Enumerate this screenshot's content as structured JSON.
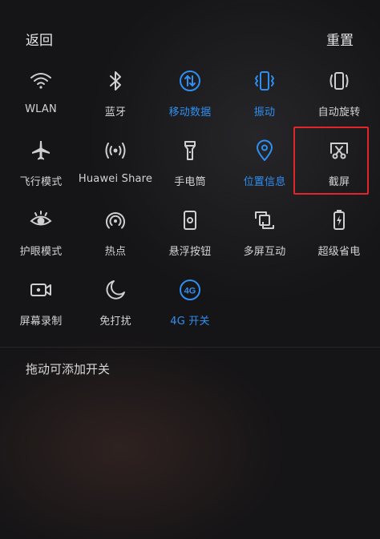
{
  "header": {
    "back_label": "返回",
    "reset_label": "重置"
  },
  "tiles": [
    {
      "label": "WLAN",
      "icon": "wifi-icon",
      "active": false
    },
    {
      "label": "蓝牙",
      "icon": "bluetooth-icon",
      "active": false
    },
    {
      "label": "移动数据",
      "icon": "mobile-data-icon",
      "active": true
    },
    {
      "label": "振动",
      "icon": "vibrate-icon",
      "active": true
    },
    {
      "label": "自动旋转",
      "icon": "auto-rotate-icon",
      "active": false
    },
    {
      "label": "飞行模式",
      "icon": "airplane-icon",
      "active": false
    },
    {
      "label": "Huawei Share",
      "icon": "huawei-share-icon",
      "active": false
    },
    {
      "label": "手电筒",
      "icon": "flashlight-icon",
      "active": false
    },
    {
      "label": "位置信息",
      "icon": "location-icon",
      "active": true
    },
    {
      "label": "截屏",
      "icon": "screenshot-icon",
      "active": false
    },
    {
      "label": "护眼模式",
      "icon": "eye-comfort-icon",
      "active": false
    },
    {
      "label": "热点",
      "icon": "hotspot-icon",
      "active": false
    },
    {
      "label": "悬浮按钮",
      "icon": "floating-button-icon",
      "active": false
    },
    {
      "label": "多屏互动",
      "icon": "multi-screen-icon",
      "active": false
    },
    {
      "label": "超级省电",
      "icon": "power-saving-icon",
      "active": false
    },
    {
      "label": "屏幕录制",
      "icon": "screen-record-icon",
      "active": false
    },
    {
      "label": "免打扰",
      "icon": "do-not-disturb-icon",
      "active": false
    },
    {
      "label": "4G 开关",
      "icon": "4g-icon",
      "active": true
    }
  ],
  "hint": "拖动可添加开关",
  "colors": {
    "active": "#2f8ff0",
    "inactive": "#d4d4d4",
    "highlight": "#e0262b"
  }
}
